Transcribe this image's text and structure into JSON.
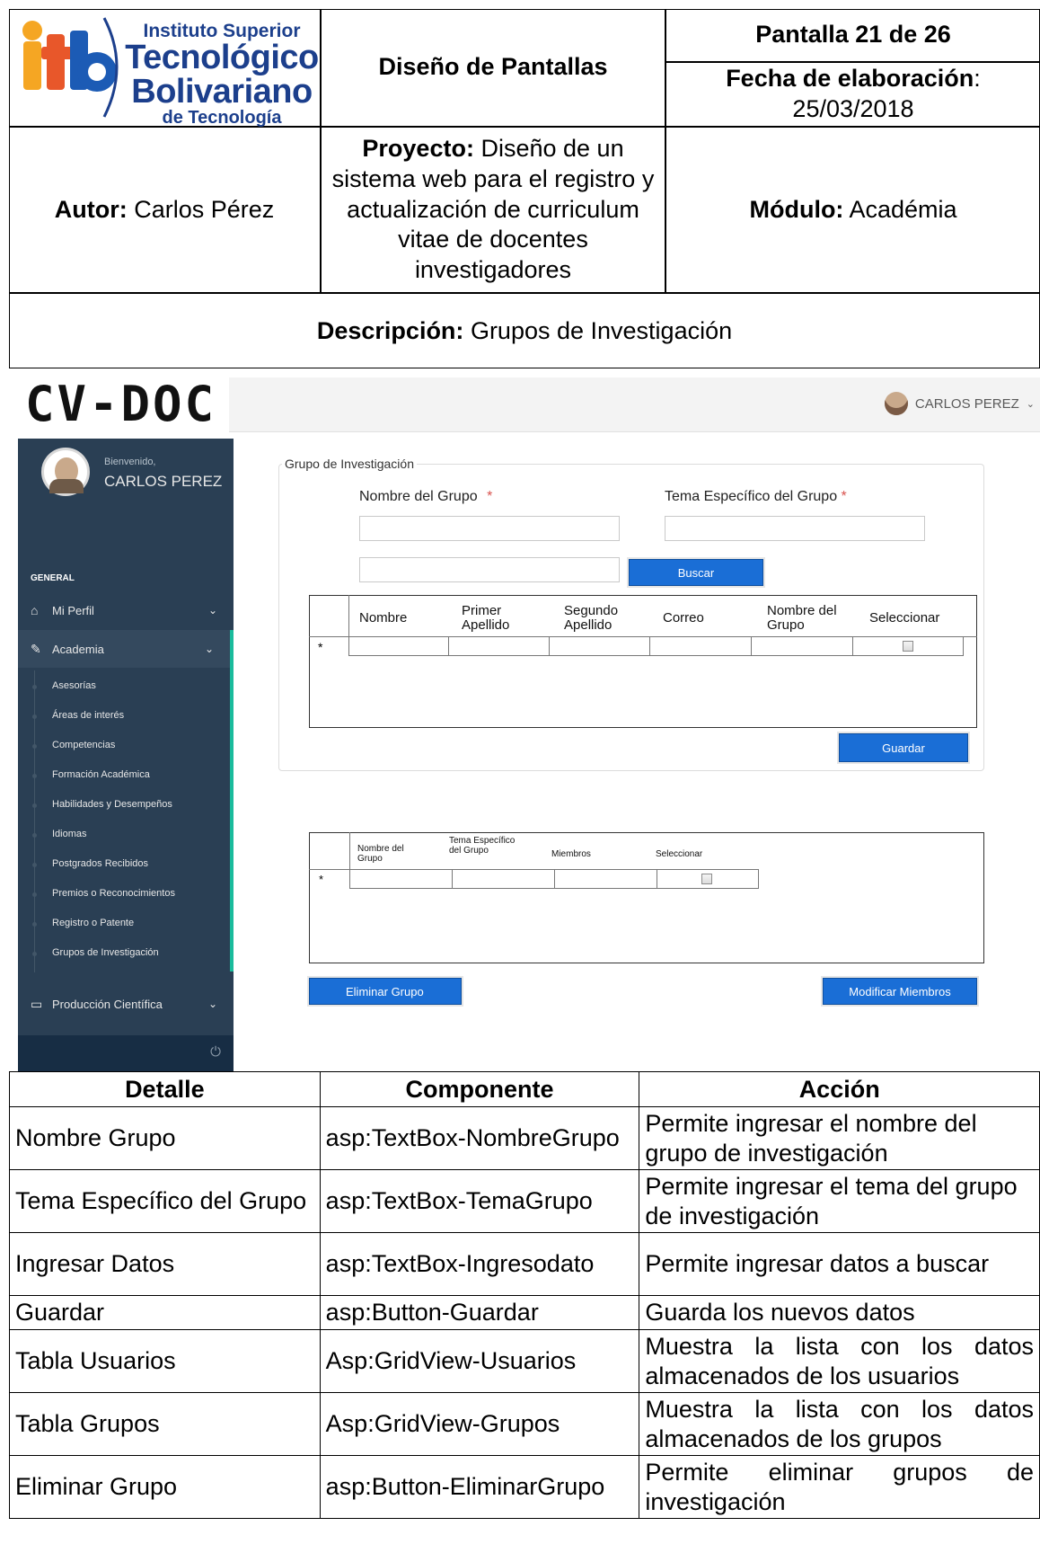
{
  "header": {
    "logo": {
      "line1": "Instituto Superior",
      "line2": "Tecnológico",
      "line3": "Bolivariano",
      "line4": "de Tecnología",
      "letters": "itb"
    },
    "doc_title": "Diseño de Pantallas",
    "screen_label": "Pantalla 21 de 26",
    "date_label": "Fecha de elaboración",
    "date_value": "25/03/2018",
    "author_label": "Autor:",
    "author_value": "Carlos Pérez",
    "project_label": "Proyecto:",
    "project_value": "Diseño de un sistema web para el registro y actualización de curriculum vitae de docentes investigadores",
    "module_label": "Módulo:",
    "module_value": "Académia",
    "description_label": "Descripción:",
    "description_value": "Grupos de Investigación"
  },
  "app": {
    "brand": "CV-DOC",
    "user_name": "CARLOS PEREZ",
    "welcome": "Bienvenido,",
    "section_label": "GENERAL",
    "menu": [
      {
        "label": "Mi Perfil",
        "icon": "home-icon"
      },
      {
        "label": "Academia",
        "icon": "edit-icon"
      },
      {
        "label": "Producción Científica",
        "icon": "monitor-icon"
      }
    ],
    "submenu": [
      "Asesorías",
      "Áreas de interés",
      "Competencias",
      "Formación Académica",
      "Habilidades y Desempeños",
      "Idiomas",
      "Postgrados Recibidos",
      "Premios o Reconocimientos",
      "Registro o Patente",
      "Grupos de Investigación"
    ],
    "form": {
      "legend": "Grupo de Investigación",
      "group_name_label": "Nombre del Grupo",
      "group_topic_label": "Tema Específico del Grupo",
      "required_mark": "*",
      "search_button": "Buscar",
      "save_button": "Guardar",
      "users_columns": [
        "Nombre",
        "Primer Apellido",
        "Segundo Apellido",
        "Correo",
        "Nombre del Grupo",
        "Seleccionar"
      ],
      "row_marker": "*"
    },
    "groups_columns": [
      "Nombre del Grupo",
      "Tema Específico del Grupo",
      "Miembros",
      "Seleccionar"
    ],
    "delete_button": "Eliminar Grupo",
    "modify_button": "Modificar Miembros"
  },
  "details_table": {
    "headers": [
      "Detalle",
      "Componente",
      "Acción"
    ],
    "rows": [
      {
        "detalle": "Nombre Grupo",
        "componente": "asp:TextBox-NombreGrupo",
        "accion": "Permite ingresar el nombre del grupo de investigación"
      },
      {
        "detalle": "Tema Específico del Grupo",
        "componente": "asp:TextBox-TemaGrupo",
        "accion": "Permite ingresar el tema del grupo de investigación"
      },
      {
        "detalle": "Ingresar Datos",
        "componente": "asp:TextBox-Ingresodato",
        "accion": "Permite ingresar datos a buscar"
      },
      {
        "detalle": "Guardar",
        "componente": "asp:Button-Guardar",
        "accion": "Guarda los nuevos datos"
      },
      {
        "detalle": "Tabla Usuarios",
        "componente": "Asp:GridView-Usuarios",
        "accion": "Muestra la lista con los datos almacenados de los usuarios"
      },
      {
        "detalle": "Tabla Grupos",
        "componente": "Asp:GridView-Grupos",
        "accion": "Muestra la lista con los datos almacenados de los grupos"
      },
      {
        "detalle": "Eliminar Grupo",
        "componente": "asp:Button-EliminarGrupo",
        "accion": "Permite eliminar grupos de investigación"
      }
    ]
  }
}
